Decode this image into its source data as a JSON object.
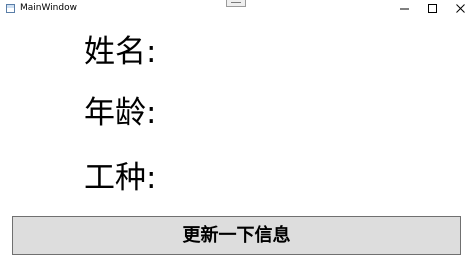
{
  "window": {
    "title": "MainWindow"
  },
  "form": {
    "name_label": "姓名:",
    "age_label": "年龄:",
    "job_label": "工种:"
  },
  "actions": {
    "update_label": "更新一下信息"
  }
}
